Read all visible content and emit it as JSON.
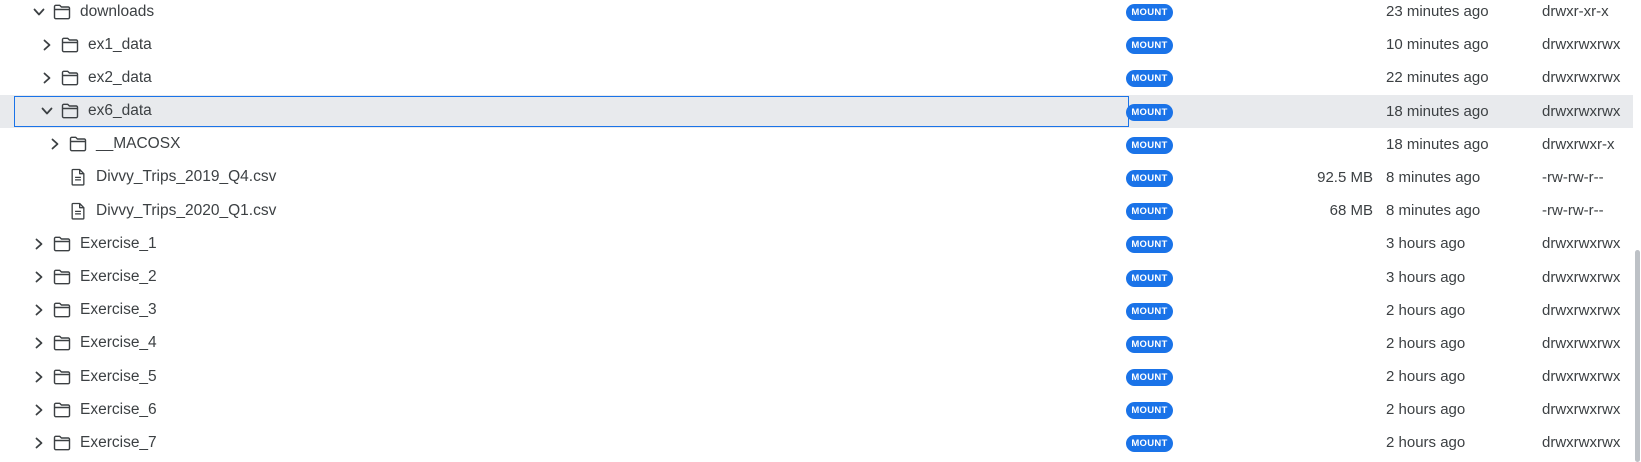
{
  "file_tree": {
    "badge_label": "MOUNT",
    "rows": [
      {
        "name": "downloads",
        "type": "folder",
        "expanded": true,
        "depth": 0,
        "size": "",
        "modified": "23 minutes ago",
        "permissions": "drwxr-xr-x",
        "selected": false
      },
      {
        "name": "ex1_data",
        "type": "folder",
        "expanded": false,
        "depth": 1,
        "size": "",
        "modified": "10 minutes ago",
        "permissions": "drwxrwxrwx",
        "selected": false
      },
      {
        "name": "ex2_data",
        "type": "folder",
        "expanded": false,
        "depth": 1,
        "size": "",
        "modified": "22 minutes ago",
        "permissions": "drwxrwxrwx",
        "selected": false
      },
      {
        "name": "ex6_data",
        "type": "folder",
        "expanded": true,
        "depth": 1,
        "size": "",
        "modified": "18 minutes ago",
        "permissions": "drwxrwxrwx",
        "selected": true
      },
      {
        "name": "__MACOSX",
        "type": "folder",
        "expanded": false,
        "depth": 2,
        "size": "",
        "modified": "18 minutes ago",
        "permissions": "drwxrwxr-x",
        "selected": false
      },
      {
        "name": "Divvy_Trips_2019_Q4.csv",
        "type": "file",
        "expanded": false,
        "depth": 2,
        "size": "92.5 MB",
        "modified": "8 minutes ago",
        "permissions": "-rw-rw-r--",
        "selected": false
      },
      {
        "name": "Divvy_Trips_2020_Q1.csv",
        "type": "file",
        "expanded": false,
        "depth": 2,
        "size": "68 MB",
        "modified": "8 minutes ago",
        "permissions": "-rw-rw-r--",
        "selected": false
      },
      {
        "name": "Exercise_1",
        "type": "folder",
        "expanded": false,
        "depth": 0,
        "size": "",
        "modified": "3 hours ago",
        "permissions": "drwxrwxrwx",
        "selected": false
      },
      {
        "name": "Exercise_2",
        "type": "folder",
        "expanded": false,
        "depth": 0,
        "size": "",
        "modified": "3 hours ago",
        "permissions": "drwxrwxrwx",
        "selected": false
      },
      {
        "name": "Exercise_3",
        "type": "folder",
        "expanded": false,
        "depth": 0,
        "size": "",
        "modified": "2 hours ago",
        "permissions": "drwxrwxrwx",
        "selected": false
      },
      {
        "name": "Exercise_4",
        "type": "folder",
        "expanded": false,
        "depth": 0,
        "size": "",
        "modified": "2 hours ago",
        "permissions": "drwxrwxrwx",
        "selected": false
      },
      {
        "name": "Exercise_5",
        "type": "folder",
        "expanded": false,
        "depth": 0,
        "size": "",
        "modified": "2 hours ago",
        "permissions": "drwxrwxrwx",
        "selected": false
      },
      {
        "name": "Exercise_6",
        "type": "folder",
        "expanded": false,
        "depth": 0,
        "size": "",
        "modified": "2 hours ago",
        "permissions": "drwxrwxrwx",
        "selected": false
      },
      {
        "name": "Exercise_7",
        "type": "folder",
        "expanded": false,
        "depth": 0,
        "size": "",
        "modified": "2 hours ago",
        "permissions": "drwxrwxrwx",
        "selected": false
      }
    ]
  },
  "colors": {
    "badge_bg": "#1a73e8",
    "selection_bg": "#e8eaed",
    "selection_border": "#1a73e8",
    "text": "#3c4043"
  },
  "icons": {
    "folder": "folder-icon",
    "file": "file-icon",
    "expanded": "chevron-down-icon",
    "collapsed": "chevron-right-icon"
  }
}
